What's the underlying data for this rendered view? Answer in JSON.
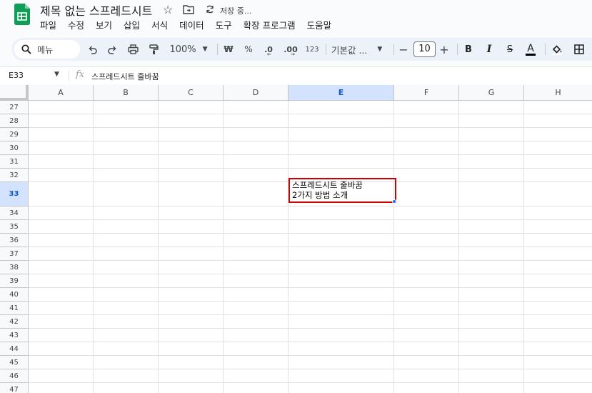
{
  "title": {
    "doc_name": "제목 없는 스프레드시트",
    "save_status": "저장 중..."
  },
  "menubar": {
    "items": [
      "파일",
      "수정",
      "보기",
      "삽입",
      "서식",
      "데이터",
      "도구",
      "확장 프로그램",
      "도움말"
    ]
  },
  "toolbar": {
    "search_label": "메뉴",
    "zoom": "100%",
    "currency": "₩",
    "percent": "%",
    "dec_decrease": ".0",
    "dec_increase": ".00",
    "number_format": "123",
    "font_name": "기본값 ...",
    "font_size": "10",
    "minus": "−",
    "plus": "+",
    "bold": "B",
    "italic": "I",
    "strike": "S",
    "text_color": "A"
  },
  "formula_bar": {
    "cell_ref": "E33",
    "fx": "fx",
    "content": "스프레드시트 줄바꿈"
  },
  "grid": {
    "columns": [
      "A",
      "B",
      "C",
      "D",
      "E",
      "F",
      "G",
      "H"
    ],
    "selected_column": "E",
    "rows": [
      "27",
      "28",
      "29",
      "30",
      "31",
      "32",
      "33",
      "34",
      "35",
      "36",
      "37",
      "38",
      "39",
      "40",
      "41",
      "42",
      "43",
      "44",
      "45",
      "46",
      "47"
    ],
    "selected_row": "33",
    "active_cell": {
      "line1": "스프레드시트 줄바꿈",
      "line2": "2가지 방법 소개"
    }
  },
  "colors": {
    "accent": "#0b57d0",
    "highlight_border": "#d10000",
    "selected_header": "#d3e3fd",
    "sheets_green": "#0f9d58"
  }
}
